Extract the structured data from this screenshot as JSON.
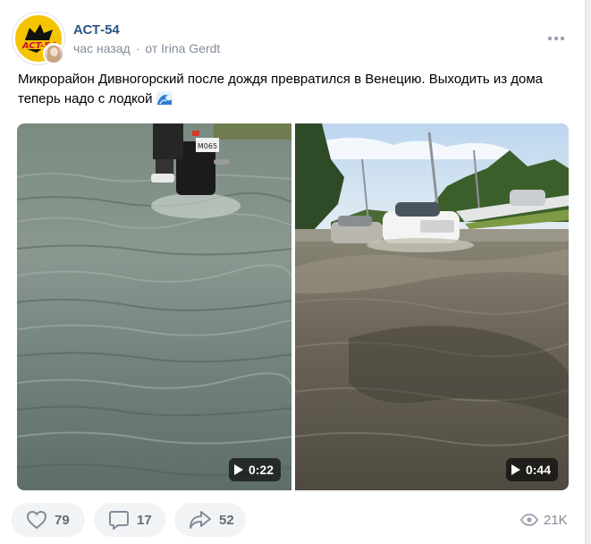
{
  "post": {
    "group_name": "АСТ-54",
    "time": "час назад",
    "separator": "·",
    "author": "от Irina Gerdt",
    "text": "Микрорайон Дивногорский после дождя превратился в Венецию. Выходить из дома теперь надо с лодкой",
    "emoji": "water-wave-icon"
  },
  "media": [
    {
      "type": "video",
      "duration": "0:22",
      "scene": "motorcycle in flooded street"
    },
    {
      "type": "video",
      "duration": "0:44",
      "scene": "white car driving through flooded road"
    }
  ],
  "actions": {
    "likes": "79",
    "comments": "17",
    "shares": "52",
    "views": "21K"
  },
  "colors": {
    "link": "#2a5885",
    "meta": "#818c99",
    "button_bg": "#f2f3f5",
    "button_text": "#626d7a",
    "logo_yellow": "#f5c400"
  }
}
